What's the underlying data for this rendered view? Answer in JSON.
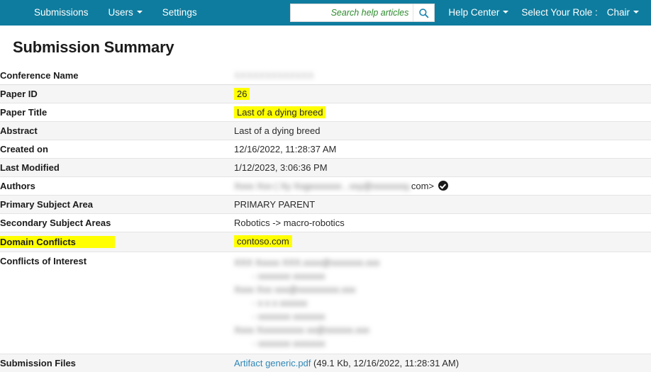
{
  "navbar": {
    "background": "#0e7c9e",
    "left_items": [
      {
        "label": "Submissions",
        "caret": false
      },
      {
        "label": "Users",
        "caret": true
      },
      {
        "label": "Settings",
        "caret": false
      }
    ],
    "search": {
      "placeholder": "Search help articles",
      "value": "",
      "icon": "search-icon"
    },
    "help_center": "Help Center",
    "role_label": "Select Your Role :",
    "role_value": "Chair"
  },
  "page": {
    "title": "Submission Summary"
  },
  "summary": {
    "labels": {
      "conference_name": "Conference Name",
      "paper_id": "Paper ID",
      "paper_title": "Paper Title",
      "abstract": "Abstract",
      "created_on": "Created on",
      "last_modified": "Last Modified",
      "authors": "Authors",
      "primary_subject_area": "Primary Subject Area",
      "secondary_subject_areas": "Secondary Subject Areas",
      "domain_conflicts": "Domain Conflicts",
      "conflicts_of_interest": "Conflicts of Interest",
      "submission_files": "Submission Files"
    },
    "values": {
      "conference_name": "XXXXXXXXXXXXX",
      "paper_id": "26",
      "paper_title": "Last of a dying breed",
      "abstract": "Last of a dying breed",
      "created_on": "12/16/2022, 11:28:37 AM",
      "last_modified": "1/12/2023, 3:06:36 PM",
      "authors_redacted": "Xxxx Xxx ( Xy Xxgxxxxxxx ,  xxy@xxxxxxxy.",
      "authors_suffix": "com>",
      "primary_subject_area": "PRIMARY PARENT",
      "secondary_subject_areas": "Robotics -> macro-robotics",
      "domain_conflicts": "contoso.com",
      "conflicts_of_interest": [
        "XXX   Xxxxx   XXX.xxxx@xxxxxxx.xxx",
        "- xxxxxxx xxxxxxx",
        "Xxxx  Xxx    xxx@xxxxxxxxx.xxx",
        "- x x x xxxxxx",
        "- xxxxxxx xxxxxxx",
        "Xxxx  Xxxxxxxxxx   xx@xxxxxx.xxx",
        "- xxxxxxx xxxxxxx"
      ]
    },
    "submission_files": {
      "file_name": "Artifact generic.pdf",
      "file_meta": "(49.1 Kb, 12/16/2022, 11:28:31 AM)"
    },
    "highlight_color": "#ffff00"
  }
}
